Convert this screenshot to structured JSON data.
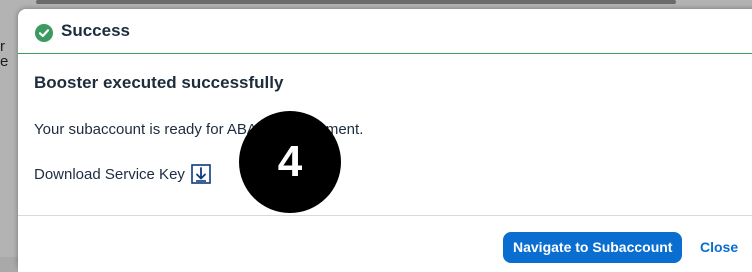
{
  "dialog": {
    "title": "Success",
    "subtitle": "Booster executed successfully",
    "message": "Your subaccount is ready for ABAP Development.",
    "download_label": "Download Service Key",
    "navigate_button": "Navigate to Subaccount",
    "close_button": "Close"
  },
  "badge": {
    "number": "4"
  },
  "backdrop": {
    "fragments": [
      "r",
      "e"
    ]
  },
  "colors": {
    "success": "#3c9a5f",
    "primary": "#0a6ed1",
    "text": "#1d2d3e"
  },
  "icons": {
    "header": "success-check-icon",
    "download": "download-arrow-icon"
  }
}
